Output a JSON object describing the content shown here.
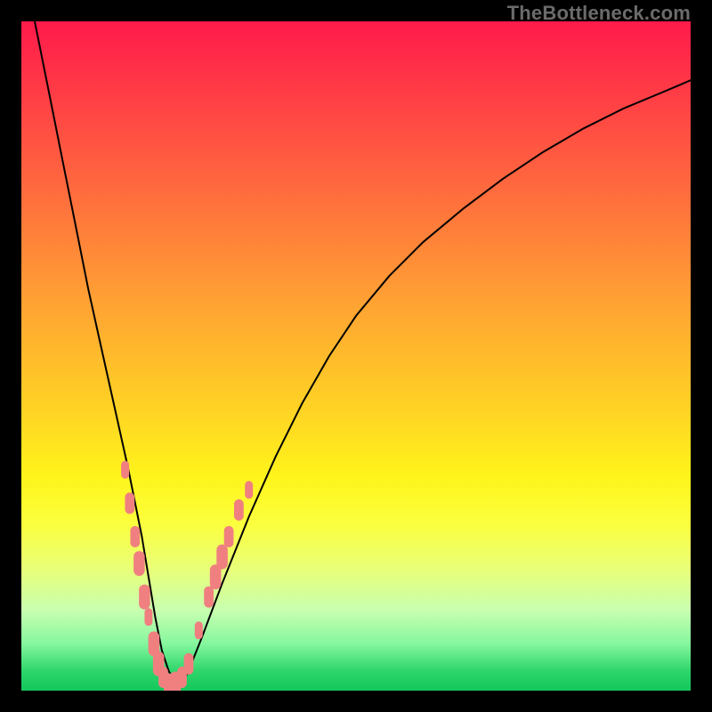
{
  "watermark": "TheBottleneck.com",
  "chart_data": {
    "type": "line",
    "title": "",
    "xlabel": "",
    "ylabel": "",
    "xlim": [
      0,
      100
    ],
    "ylim": [
      0,
      100
    ],
    "grid": false,
    "legend": false,
    "series": [
      {
        "name": "curve",
        "x": [
          2,
          4,
          6,
          8,
          10,
          12,
          14,
          16,
          18,
          19,
          20,
          21,
          22,
          23,
          24,
          25,
          27,
          30,
          34,
          38,
          42,
          46,
          50,
          55,
          60,
          66,
          72,
          78,
          84,
          90,
          96,
          100
        ],
        "y": [
          100,
          90,
          80,
          70,
          60,
          51,
          42,
          33,
          23,
          17,
          11,
          6,
          3,
          1,
          1,
          3,
          8,
          16,
          26,
          35,
          43,
          50,
          56,
          62,
          67,
          72,
          76.5,
          80.5,
          84,
          87,
          89.5,
          91.2
        ]
      }
    ],
    "scatter": {
      "name": "markers",
      "points": [
        {
          "x": 15.5,
          "y": 33,
          "r": 2.0
        },
        {
          "x": 16.2,
          "y": 28,
          "r": 2.4
        },
        {
          "x": 17.0,
          "y": 23,
          "r": 2.4
        },
        {
          "x": 17.6,
          "y": 19,
          "r": 2.8
        },
        {
          "x": 18.4,
          "y": 14,
          "r": 2.8
        },
        {
          "x": 19.0,
          "y": 11,
          "r": 2.0
        },
        {
          "x": 19.8,
          "y": 7,
          "r": 2.8
        },
        {
          "x": 20.5,
          "y": 4,
          "r": 2.8
        },
        {
          "x": 21.2,
          "y": 2,
          "r": 2.4
        },
        {
          "x": 22.0,
          "y": 1,
          "r": 2.4
        },
        {
          "x": 23.0,
          "y": 1,
          "r": 2.8
        },
        {
          "x": 24.0,
          "y": 2,
          "r": 2.4
        },
        {
          "x": 25.0,
          "y": 4,
          "r": 2.4
        },
        {
          "x": 26.5,
          "y": 9,
          "r": 2.0
        },
        {
          "x": 28.0,
          "y": 14,
          "r": 2.4
        },
        {
          "x": 29.0,
          "y": 17,
          "r": 2.8
        },
        {
          "x": 30.0,
          "y": 20,
          "r": 2.8
        },
        {
          "x": 31.0,
          "y": 23,
          "r": 2.4
        },
        {
          "x": 32.5,
          "y": 27,
          "r": 2.4
        },
        {
          "x": 34.0,
          "y": 30,
          "r": 2.0
        }
      ]
    },
    "marker_color": "#f08080",
    "curve_color": "#000000"
  }
}
